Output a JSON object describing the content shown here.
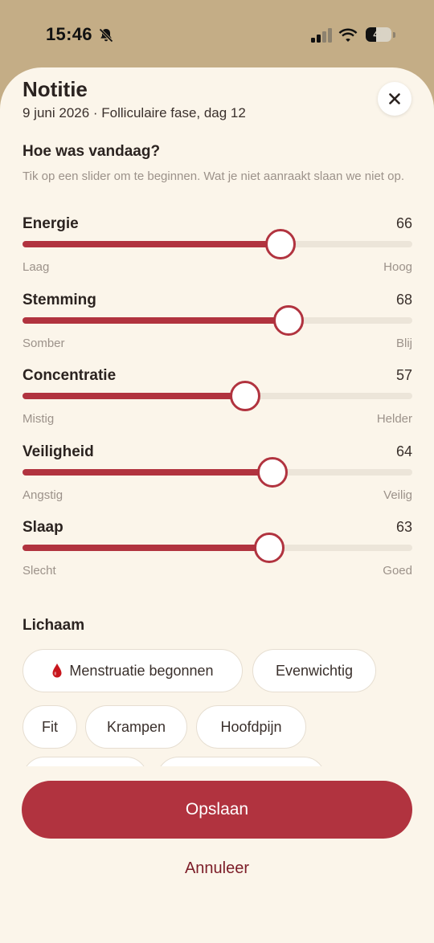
{
  "status_bar": {
    "time": "15:46",
    "battery": "41",
    "battery_level": 0.41,
    "icons": [
      "bell-slash-icon",
      "cellular-signal-icon",
      "wifi-icon",
      "battery-icon"
    ]
  },
  "sheet": {
    "title": "Notitie",
    "subtitle": "9 juni 2026 · Folliculaire fase, dag 12",
    "close_icon": "close-icon"
  },
  "mood": {
    "question": "Hoe was vandaag?",
    "hint": "Tik op een slider om te beginnen. Wat je niet aanraakt slaan we niet op.",
    "sliders": [
      {
        "label": "Energie",
        "value": "66",
        "level": 66,
        "min_label": "Laag",
        "max_label": "Hoog"
      },
      {
        "label": "Stemming",
        "value": "68",
        "level": 68,
        "min_label": "Somber",
        "max_label": "Blij"
      },
      {
        "label": "Concentratie",
        "value": "57",
        "level": 57,
        "min_label": "Mistig",
        "max_label": "Helder"
      },
      {
        "label": "Veiligheid",
        "value": "64",
        "level": 64,
        "min_label": "Angstig",
        "max_label": "Veilig"
      },
      {
        "label": "Slaap",
        "value": "63",
        "level": 63,
        "min_label": "Slecht",
        "max_label": "Goed"
      }
    ]
  },
  "body": {
    "title": "Lichaam",
    "chips": [
      {
        "label": "Menstruatie begonnen",
        "icon": "blood-drop-icon"
      },
      {
        "label": "Evenwichtig"
      },
      {
        "label": "Fit"
      },
      {
        "label": "Krampen"
      },
      {
        "label": "Hoofdpijn"
      }
    ]
  },
  "actions": {
    "save_label": "Opslaan",
    "cancel_label": "Annuleer"
  },
  "colors": {
    "accent": "#b1333f",
    "sheet_background": "#fbf5ea",
    "backdrop": "#c4ad86"
  }
}
